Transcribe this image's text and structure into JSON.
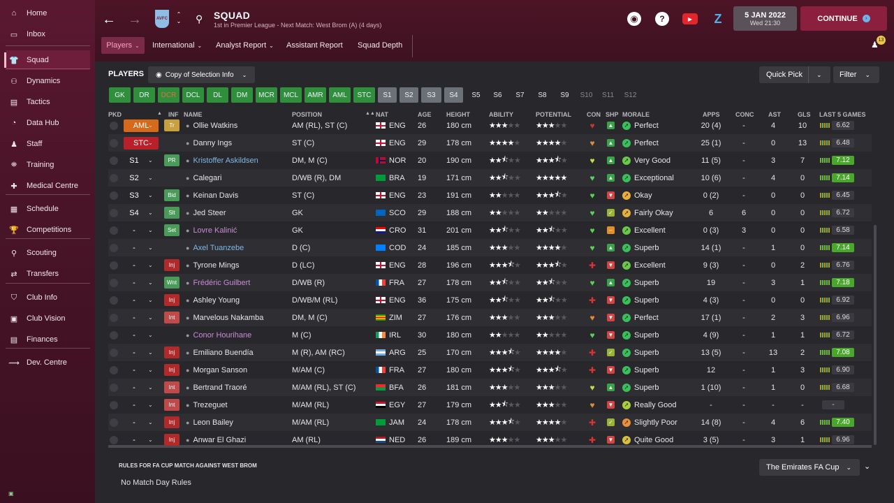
{
  "sidebar": {
    "items": [
      {
        "label": "Home",
        "icon": "home-icon"
      },
      {
        "label": "Inbox",
        "icon": "inbox-icon"
      },
      {
        "label": "Squad",
        "icon": "shirt-icon"
      },
      {
        "label": "Dynamics",
        "icon": "people-icon"
      },
      {
        "label": "Tactics",
        "icon": "clipboard-icon"
      },
      {
        "label": "Data Hub",
        "icon": "data-hub-icon"
      },
      {
        "label": "Staff",
        "icon": "staff-icon"
      },
      {
        "label": "Training",
        "icon": "training-icon"
      },
      {
        "label": "Medical Centre",
        "icon": "medical-icon"
      },
      {
        "label": "Schedule",
        "icon": "calendar-icon"
      },
      {
        "label": "Competitions",
        "icon": "trophy-icon"
      },
      {
        "label": "Scouting",
        "icon": "search-icon"
      },
      {
        "label": "Transfers",
        "icon": "transfer-icon"
      },
      {
        "label": "Club Info",
        "icon": "shield-icon"
      },
      {
        "label": "Club Vision",
        "icon": "briefcase-icon"
      },
      {
        "label": "Finances",
        "icon": "money-icon"
      },
      {
        "label": "Dev. Centre",
        "icon": "development-icon"
      }
    ]
  },
  "header": {
    "title": "SQUAD",
    "subtitle": "1st in Premier League - Next Match: West Brom (A) (4 days)",
    "club_badge": "AVFC",
    "date": "5 JAN 2022",
    "day_time": "Wed 21:30",
    "continue_label": "CONTINUE",
    "notification_count": "13"
  },
  "subtabs": [
    {
      "label": "Players",
      "dropdown": true
    },
    {
      "label": "International",
      "dropdown": true
    },
    {
      "label": "Analyst Report",
      "dropdown": true
    },
    {
      "label": "Assistant Report",
      "dropdown": false
    },
    {
      "label": "Squad Depth",
      "dropdown": false
    }
  ],
  "players_panel": {
    "title": "PLAYERS",
    "view_label": "Copy of Selection Info",
    "quick_pick": "Quick Pick",
    "filter": "Filter"
  },
  "positions": [
    {
      "label": "GK",
      "style": "green"
    },
    {
      "label": "DR",
      "style": "green"
    },
    {
      "label": "DCR",
      "style": "red"
    },
    {
      "label": "DCL",
      "style": "green"
    },
    {
      "label": "DL",
      "style": "green"
    },
    {
      "label": "DM",
      "style": "green"
    },
    {
      "label": "MCR",
      "style": "green"
    },
    {
      "label": "MCL",
      "style": "green"
    },
    {
      "label": "AMR",
      "style": "green"
    },
    {
      "label": "AML",
      "style": "green"
    },
    {
      "label": "STC",
      "style": "green"
    },
    {
      "label": "S1",
      "style": "grey"
    },
    {
      "label": "S2",
      "style": "grey"
    },
    {
      "label": "S3",
      "style": "grey"
    },
    {
      "label": "S4",
      "style": "grey"
    },
    {
      "label": "S5",
      "style": "dark"
    },
    {
      "label": "S6",
      "style": "dark"
    },
    {
      "label": "S7",
      "style": "dark"
    },
    {
      "label": "S8",
      "style": "dark"
    },
    {
      "label": "S9",
      "style": "dark"
    },
    {
      "label": "S10",
      "style": "dim"
    },
    {
      "label": "S11",
      "style": "dim"
    },
    {
      "label": "S12",
      "style": "dim"
    }
  ],
  "columns": {
    "pkd": "PKD",
    "inf": "INF",
    "name": "NAME",
    "position": "POSITION",
    "nat": "NAT",
    "age": "AGE",
    "height": "HEIGHT",
    "ability": "ABILITY",
    "potential": "POTENTIAL",
    "con": "CON",
    "shp": "SHP",
    "morale": "MORALE",
    "apps": "APPS",
    "conc": "CONC",
    "ast": "AST",
    "gls": "GLS",
    "last5": "LAST 5 GAMES"
  },
  "players": [
    {
      "pkd": "AML",
      "pkd_style": "orange",
      "inf": "Tr",
      "name": "Ollie Watkins",
      "name_color": "#e6e6e8",
      "position": "AM (RL), ST (C)",
      "nat": "ENG",
      "age": "26",
      "height": "180 cm",
      "ability": 3,
      "potential": 3,
      "con": "heart-red",
      "shp": "up",
      "morale": "Perfect",
      "apps": "20 (4)",
      "conc": "-",
      "ast": "4",
      "gls": "10",
      "rating": "6.62",
      "rating_good": false
    },
    {
      "pkd": "STC",
      "pkd_style": "red",
      "inf": "",
      "name": "Danny Ings",
      "name_color": "#e6e6e8",
      "position": "ST (C)",
      "nat": "ENG",
      "age": "29",
      "height": "178 cm",
      "ability": 4,
      "potential": 4,
      "con": "heart-orange",
      "shp": "up",
      "morale": "Perfect",
      "apps": "25 (1)",
      "conc": "-",
      "ast": "0",
      "gls": "13",
      "rating": "6.48",
      "rating_good": false
    },
    {
      "pkd": "S1",
      "pkd_style": "none",
      "inf": "PR",
      "name": "Kristoffer Askildsen",
      "name_color": "#7fb8e8",
      "position": "DM, M (C)",
      "nat": "NOR",
      "age": "20",
      "height": "190 cm",
      "ability": 2.5,
      "potential": 3.5,
      "con": "heart-yellow",
      "shp": "up",
      "morale": "Very Good",
      "apps": "11 (5)",
      "conc": "-",
      "ast": "3",
      "gls": "7",
      "rating": "7.12",
      "rating_good": true
    },
    {
      "pkd": "S2",
      "pkd_style": "none",
      "inf": "",
      "name": "Calegari",
      "name_color": "#e6e6e8",
      "position": "D/WB (R), DM",
      "nat": "BRA",
      "age": "19",
      "height": "171 cm",
      "ability": 2.5,
      "potential": 5,
      "con": "heart-green",
      "shp": "up",
      "morale": "Exceptional",
      "apps": "10 (6)",
      "conc": "-",
      "ast": "4",
      "gls": "0",
      "rating": "7.14",
      "rating_good": true
    },
    {
      "pkd": "S3",
      "pkd_style": "none",
      "inf": "Bid",
      "name": "Keinan Davis",
      "name_color": "#e6e6e8",
      "position": "ST (C)",
      "nat": "ENG",
      "age": "23",
      "height": "191 cm",
      "ability": 2,
      "potential": 3.5,
      "con": "heart-green",
      "shp": "down",
      "morale": "Okay",
      "apps": "0 (2)",
      "conc": "-",
      "ast": "0",
      "gls": "0",
      "rating": "6.45",
      "rating_good": false
    },
    {
      "pkd": "S4",
      "pkd_style": "none",
      "inf": "Slt",
      "name": "Jed Steer",
      "name_color": "#e6e6e8",
      "position": "GK",
      "nat": "SCO",
      "age": "29",
      "height": "188 cm",
      "ability": 2,
      "potential": 2,
      "con": "heart-green",
      "shp": "yes",
      "morale": "Fairly Okay",
      "apps": "6",
      "conc": "6",
      "ast": "0",
      "gls": "0",
      "rating": "6.72",
      "rating_good": false
    },
    {
      "pkd": "-",
      "pkd_style": "none",
      "inf": "Set",
      "name": "Lovre Kalinić",
      "name_color": "#c98bd6",
      "position": "GK",
      "nat": "CRO",
      "age": "31",
      "height": "201 cm",
      "ability": 2.5,
      "potential": 2.5,
      "con": "heart-green",
      "shp": "minus",
      "morale": "Excellent",
      "apps": "0 (3)",
      "conc": "3",
      "ast": "0",
      "gls": "0",
      "rating": "6.58",
      "rating_good": false
    },
    {
      "pkd": "-",
      "pkd_style": "none",
      "inf": "",
      "name": "Axel Tuanzebe",
      "name_color": "#7fb8e8",
      "position": "D (C)",
      "nat": "COD",
      "age": "24",
      "height": "185 cm",
      "ability": 3,
      "potential": 4,
      "con": "heart-green",
      "shp": "up",
      "morale": "Superb",
      "apps": "14 (1)",
      "conc": "-",
      "ast": "1",
      "gls": "0",
      "rating": "7.14",
      "rating_good": true
    },
    {
      "pkd": "-",
      "pkd_style": "none",
      "inf": "Inj",
      "name": "Tyrone Mings",
      "name_color": "#e6e6e8",
      "position": "D (LC)",
      "nat": "ENG",
      "age": "28",
      "height": "196 cm",
      "ability": 3.5,
      "potential": 3.5,
      "con": "injury",
      "shp": "down",
      "morale": "Excellent",
      "apps": "9 (3)",
      "conc": "-",
      "ast": "0",
      "gls": "2",
      "rating": "6.76",
      "rating_good": false
    },
    {
      "pkd": "-",
      "pkd_style": "none",
      "inf": "Wnt",
      "name": "Frédéric Guilbert",
      "name_color": "#c98bd6",
      "position": "D/WB (R)",
      "nat": "FRA",
      "age": "27",
      "height": "178 cm",
      "ability": 2.5,
      "potential": 2.5,
      "con": "heart-green",
      "shp": "up",
      "morale": "Superb",
      "apps": "19",
      "conc": "-",
      "ast": "3",
      "gls": "1",
      "rating": "7.18",
      "rating_good": true
    },
    {
      "pkd": "-",
      "pkd_style": "none",
      "inf": "Inj",
      "name": "Ashley Young",
      "name_color": "#e6e6e8",
      "position": "D/WB/M (RL)",
      "nat": "ENG",
      "age": "36",
      "height": "175 cm",
      "ability": 2.5,
      "potential": 2.5,
      "con": "injury",
      "shp": "down",
      "morale": "Superb",
      "apps": "4 (3)",
      "conc": "-",
      "ast": "0",
      "gls": "0",
      "rating": "6.92",
      "rating_good": false
    },
    {
      "pkd": "-",
      "pkd_style": "none",
      "inf": "Int",
      "name": "Marvelous Nakamba",
      "name_color": "#e6e6e8",
      "position": "DM, M (C)",
      "nat": "ZIM",
      "age": "27",
      "height": "176 cm",
      "ability": 3,
      "potential": 3,
      "con": "heart-orange",
      "shp": "down",
      "morale": "Perfect",
      "apps": "17 (1)",
      "conc": "-",
      "ast": "2",
      "gls": "3",
      "rating": "6.96",
      "rating_good": false
    },
    {
      "pkd": "-",
      "pkd_style": "none",
      "inf": "",
      "name": "Conor Hourihane",
      "name_color": "#c98bd6",
      "position": "M (C)",
      "nat": "IRL",
      "age": "30",
      "height": "180 cm",
      "ability": 2,
      "potential": 2,
      "con": "heart-green",
      "shp": "down",
      "morale": "Superb",
      "apps": "4 (9)",
      "conc": "-",
      "ast": "1",
      "gls": "1",
      "rating": "6.72",
      "rating_good": false
    },
    {
      "pkd": "-",
      "pkd_style": "none",
      "inf": "Inj",
      "name": "Emiliano Buendía",
      "name_color": "#e6e6e8",
      "position": "M (R), AM (RC)",
      "nat": "ARG",
      "age": "25",
      "height": "170 cm",
      "ability": 3.5,
      "potential": 4,
      "con": "injury",
      "shp": "yes",
      "morale": "Superb",
      "apps": "13 (5)",
      "conc": "-",
      "ast": "13",
      "gls": "2",
      "rating": "7.08",
      "rating_good": true
    },
    {
      "pkd": "-",
      "pkd_style": "none",
      "inf": "Inj",
      "name": "Morgan Sanson",
      "name_color": "#e6e6e8",
      "position": "M/AM (C)",
      "nat": "FRA",
      "age": "27",
      "height": "180 cm",
      "ability": 3.5,
      "potential": 3.5,
      "con": "injury",
      "shp": "down",
      "morale": "Superb",
      "apps": "12",
      "conc": "-",
      "ast": "1",
      "gls": "3",
      "rating": "6.90",
      "rating_good": false
    },
    {
      "pkd": "-",
      "pkd_style": "none",
      "inf": "Int",
      "name": "Bertrand Traoré",
      "name_color": "#e6e6e8",
      "position": "M/AM (RL), ST (C)",
      "nat": "BFA",
      "age": "26",
      "height": "181 cm",
      "ability": 3,
      "potential": 3,
      "con": "heart-yellow",
      "shp": "up2",
      "morale": "Superb",
      "apps": "1 (10)",
      "conc": "-",
      "ast": "1",
      "gls": "0",
      "rating": "6.68",
      "rating_good": false
    },
    {
      "pkd": "-",
      "pkd_style": "none",
      "inf": "Int",
      "name": "Trezeguet",
      "name_color": "#e6e6e8",
      "position": "M/AM (RL)",
      "nat": "EGY",
      "age": "27",
      "height": "179 cm",
      "ability": 2.5,
      "potential": 3,
      "con": "heart-orange",
      "shp": "down",
      "morale": "Really Good",
      "apps": "-",
      "conc": "-",
      "ast": "-",
      "gls": "-",
      "rating": "-",
      "rating_good": false
    },
    {
      "pkd": "-",
      "pkd_style": "none",
      "inf": "Inj",
      "name": "Leon Bailey",
      "name_color": "#e6e6e8",
      "position": "M/AM (RL)",
      "nat": "JAM",
      "age": "24",
      "height": "178 cm",
      "ability": 3.5,
      "potential": 4,
      "con": "injury",
      "shp": "yes",
      "morale": "Slightly Poor",
      "apps": "14 (8)",
      "conc": "-",
      "ast": "4",
      "gls": "6",
      "rating": "7.40",
      "rating_good": true
    },
    {
      "pkd": "-",
      "pkd_style": "none",
      "inf": "Inj",
      "name": "Anwar El Ghazi",
      "name_color": "#e6e6e8",
      "position": "AM (RL)",
      "nat": "NED",
      "age": "26",
      "height": "189 cm",
      "ability": 3,
      "potential": 3,
      "con": "injury",
      "shp": "down",
      "morale": "Quite Good",
      "apps": "3 (5)",
      "conc": "-",
      "ast": "3",
      "gls": "1",
      "rating": "6.96",
      "rating_good": false
    }
  ],
  "footer": {
    "rules_title": "RULES FOR FA CUP MATCH AGAINST WEST BROM",
    "rules_text": "No Match Day Rules",
    "competition": "The Emirates FA Cup"
  }
}
